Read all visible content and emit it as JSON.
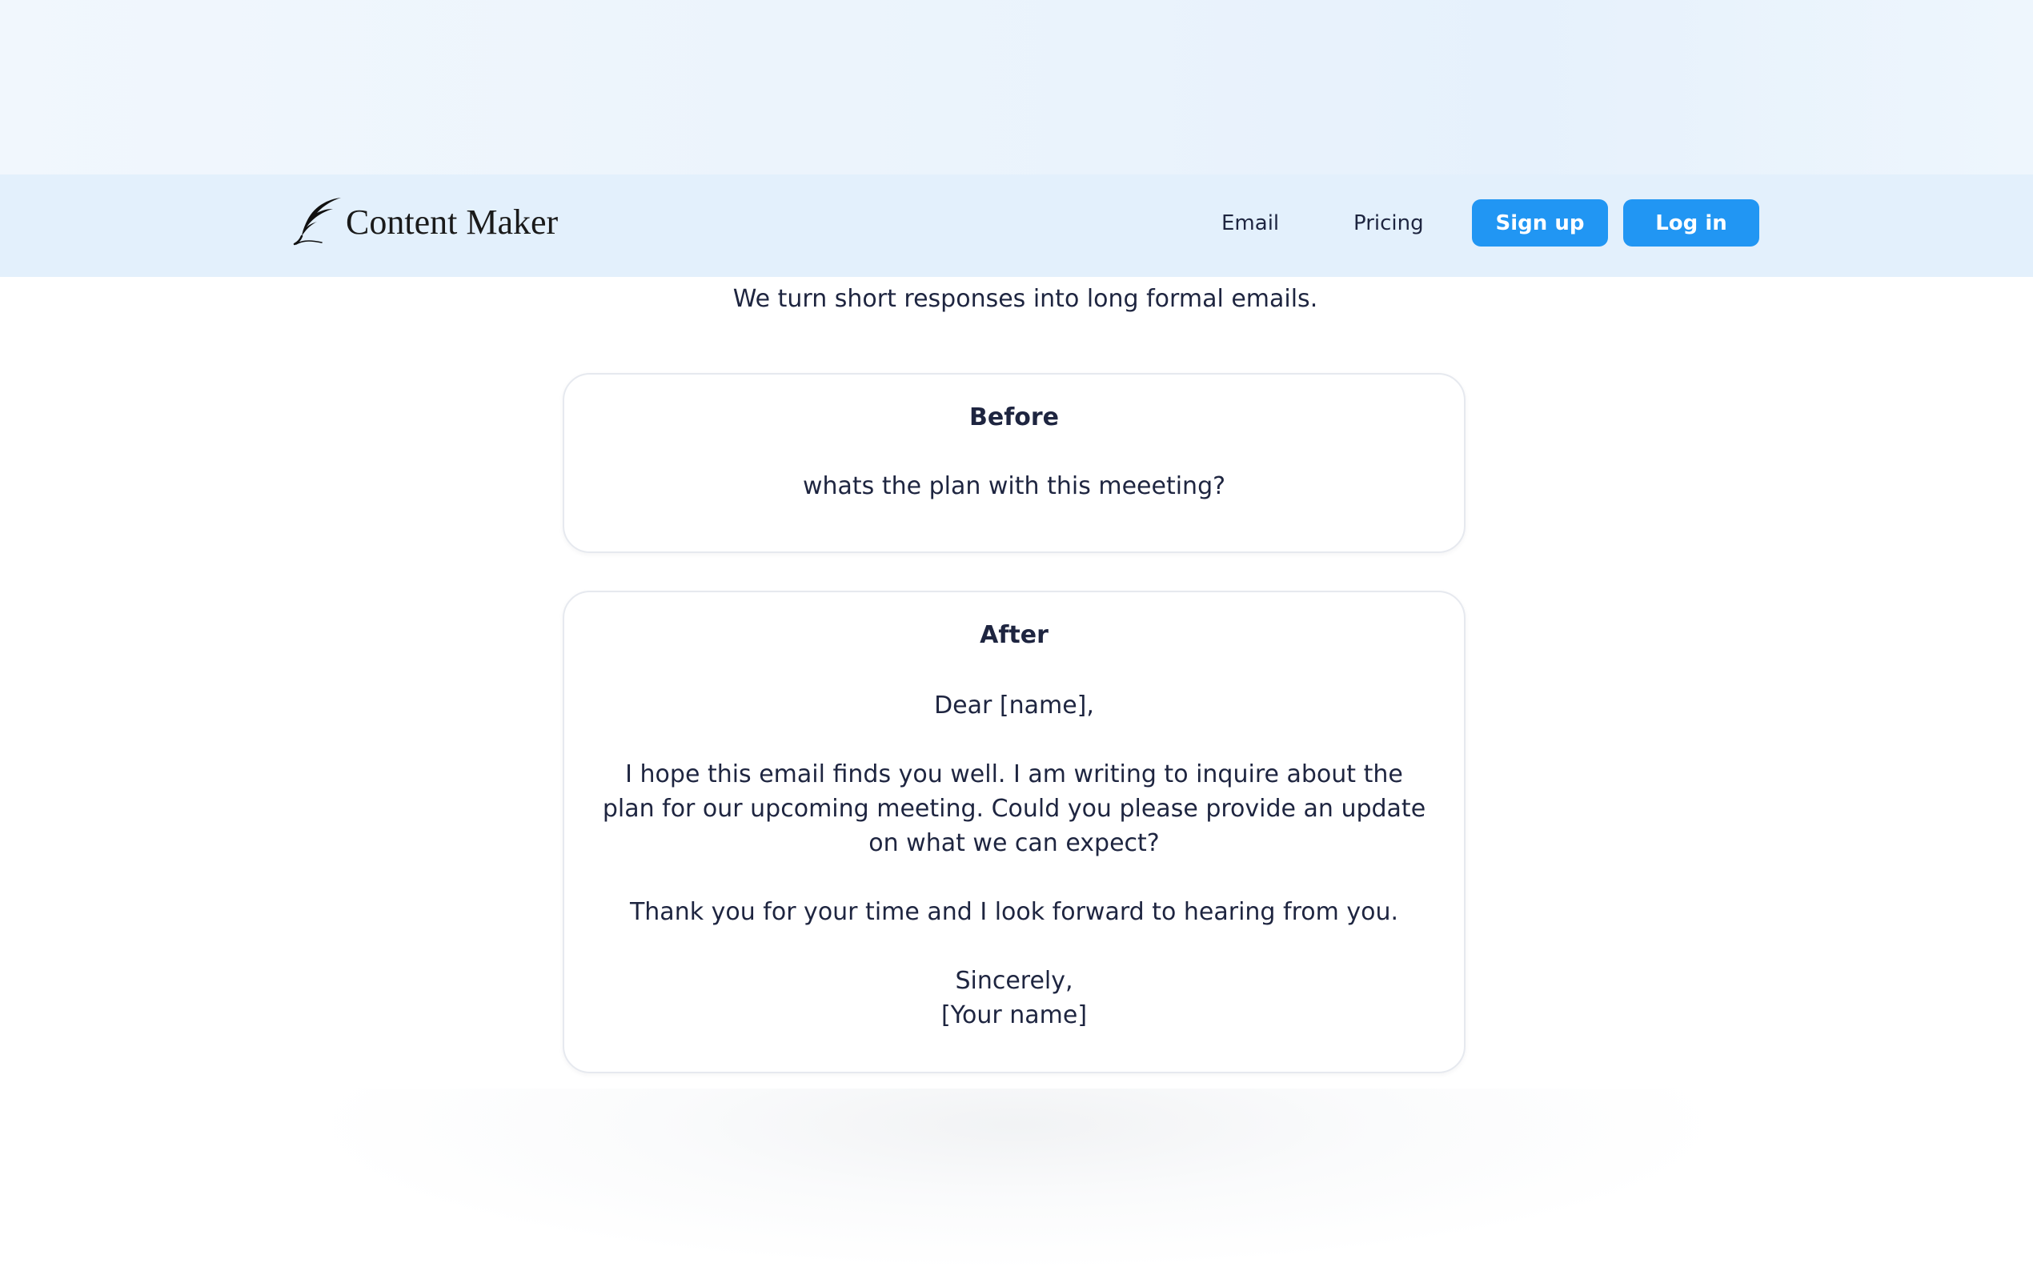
{
  "brand": {
    "name": "Content Maker",
    "logo_icon": "quill-feather-icon"
  },
  "nav": {
    "links": [
      "Email",
      "Pricing"
    ],
    "signup_label": "Sign up",
    "login_label": "Log in"
  },
  "hero": {
    "tagline": "We turn short responses into long formal emails."
  },
  "before_card": {
    "title": "Before",
    "text": "whats the plan with this meeeting?"
  },
  "after_card": {
    "title": "After",
    "greeting": "Dear [name],",
    "body": "I hope this email finds you well. I am writing to inquire about the plan for our upcoming meeting. Could you please provide an update on what we can expect?",
    "closing_line": "Thank you for your time and I look forward to hearing from you.",
    "signoff": "Sincerely,",
    "signature": "[Your name]"
  },
  "colors": {
    "accent": "#2196f3",
    "navbar_bg": "#e3f0fc",
    "text": "#1e2540"
  }
}
